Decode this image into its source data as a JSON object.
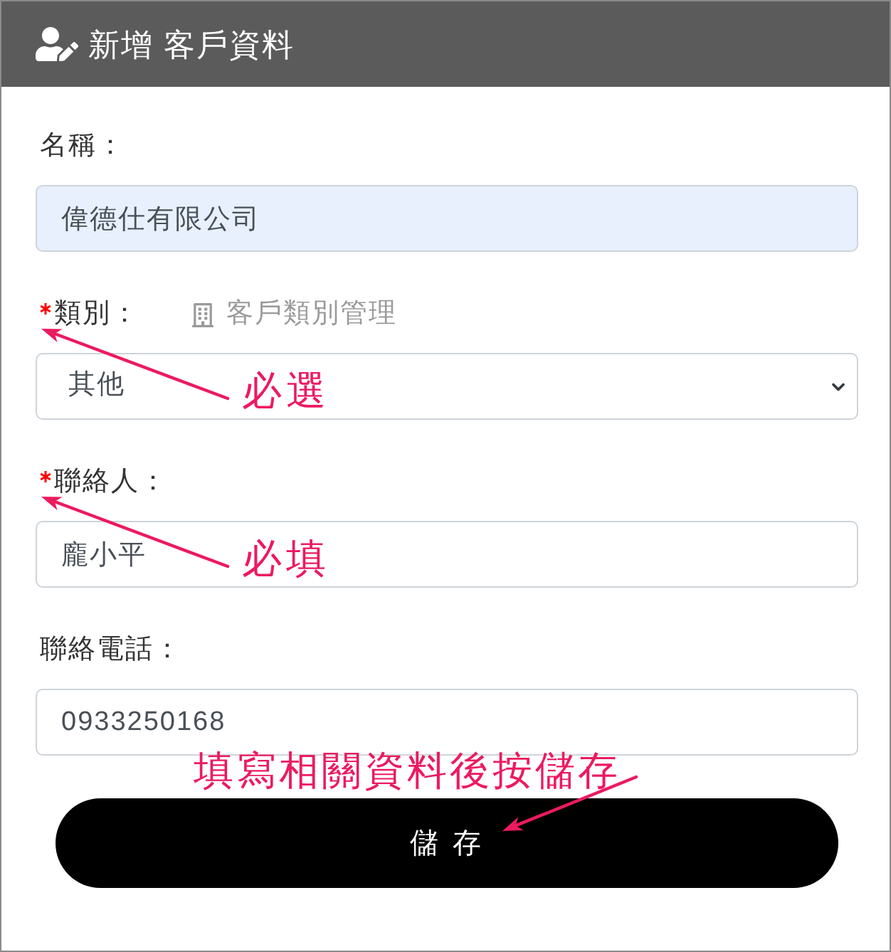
{
  "header": {
    "title": "新增 客戶資料"
  },
  "fields": [
    {
      "kind": "input",
      "label": "名稱：",
      "required": false,
      "autofilled": true,
      "value": "偉德仕有限公司"
    },
    {
      "kind": "select",
      "label": "類別：",
      "required": true,
      "value": "其他",
      "link": {
        "label": "客戶類別管理"
      },
      "annotation": "必選"
    },
    {
      "kind": "input",
      "label": "聯絡人：",
      "required": true,
      "autofilled": false,
      "value": "龐小平",
      "annotation": "必填"
    },
    {
      "kind": "input",
      "label": "聯絡電話：",
      "required": false,
      "autofilled": false,
      "value": "0933250168"
    }
  ],
  "save_button": {
    "label": "儲 存",
    "annotation": "填寫相關資料後按儲存"
  }
}
